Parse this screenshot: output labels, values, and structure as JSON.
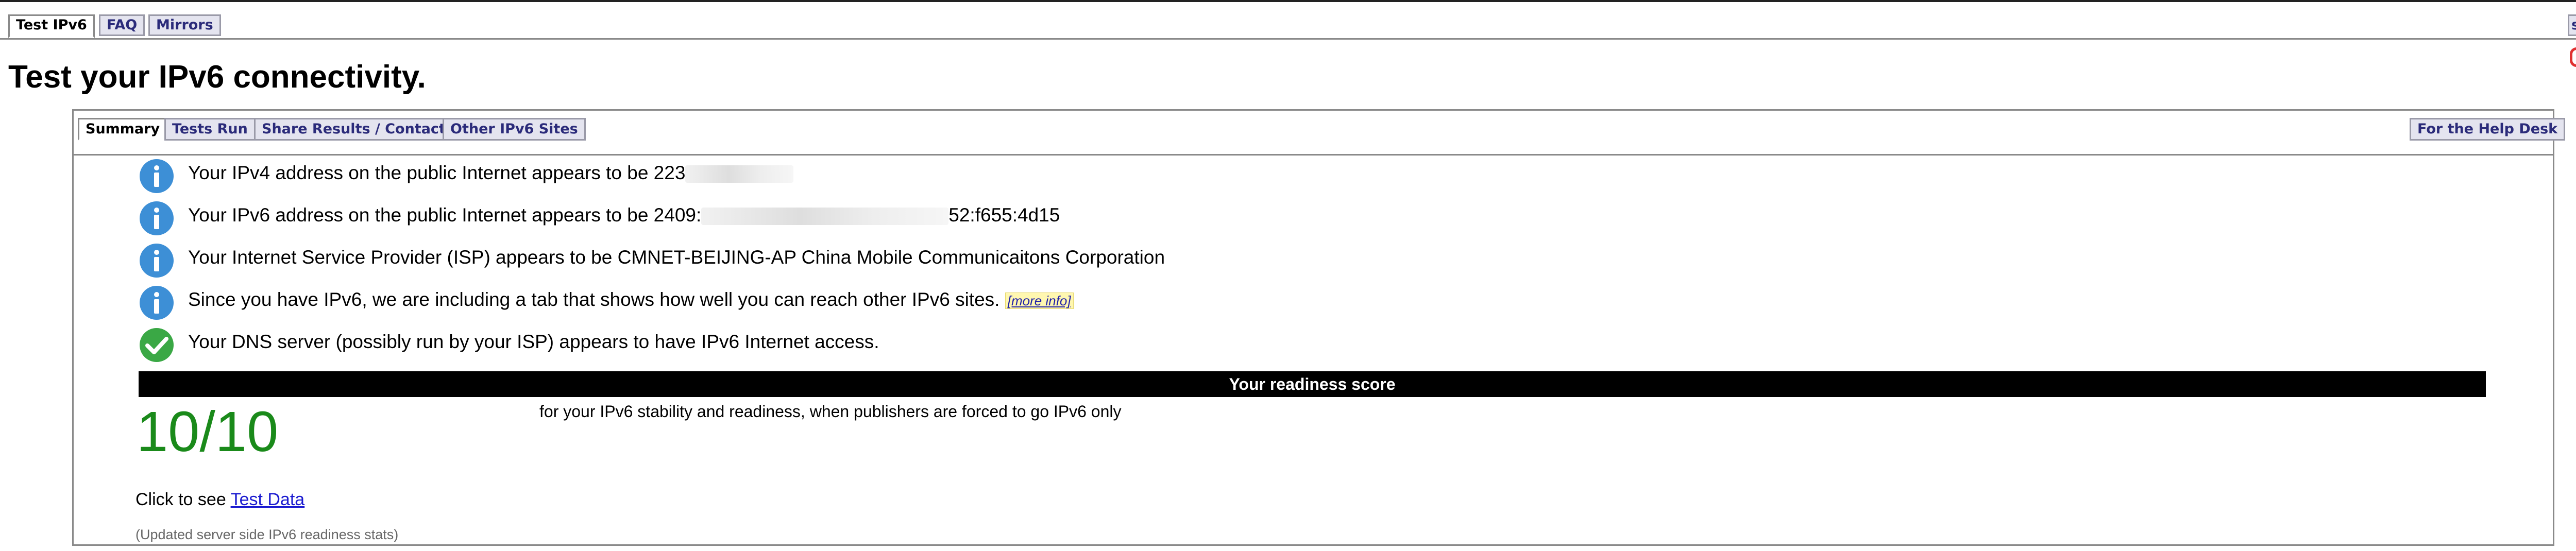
{
  "top_tabs": [
    {
      "label": "Test IPv6",
      "active": true
    },
    {
      "label": "FAQ",
      "active": false
    },
    {
      "label": "Mirrors",
      "active": false
    },
    {
      "label": "s",
      "active": false
    }
  ],
  "page_title": "Test your IPv6 connectivity.",
  "sub_tabs": [
    {
      "label": "Summary",
      "active": true
    },
    {
      "label": "Tests Run",
      "active": false
    },
    {
      "label": "Share Results / Contact",
      "active": false
    },
    {
      "label": "Other IPv6 Sites",
      "active": false
    }
  ],
  "help_desk_label": "For the Help Desk",
  "results": [
    {
      "icon": "info-icon",
      "text_before": "Your IPv4 address on the public Internet appears to be 223",
      "text_after": ""
    },
    {
      "icon": "info-icon",
      "text_before": "Your IPv6 address on the public Internet appears to be 2409:",
      "text_after": "52:f655:4d15"
    },
    {
      "icon": "info-icon",
      "text": "Your Internet Service Provider (ISP) appears to be CMNET-BEIJING-AP China Mobile Communicaitons Corporation"
    },
    {
      "icon": "info-icon",
      "text": "Since you have IPv6, we are including a tab that shows how well you can reach other IPv6 sites.",
      "link": "[more info]"
    },
    {
      "icon": "check-icon",
      "text": "Your DNS server (possibly run by your ISP) appears to have IPv6 Internet access."
    }
  ],
  "readiness": {
    "header": "Your readiness score",
    "score": "10/10",
    "description": "for your IPv6 stability and readiness, when publishers are forced to go IPv6 only"
  },
  "click_to_see": {
    "prefix": "Click to see",
    "link": "Test Data"
  },
  "updated_note": "(Updated server side IPv6 readiness stats)",
  "colors": {
    "info_blue": "#3d8fd6",
    "check_green": "#3aa845",
    "score_green": "#1a8a1a",
    "tab_text": "#2b2b7a"
  }
}
